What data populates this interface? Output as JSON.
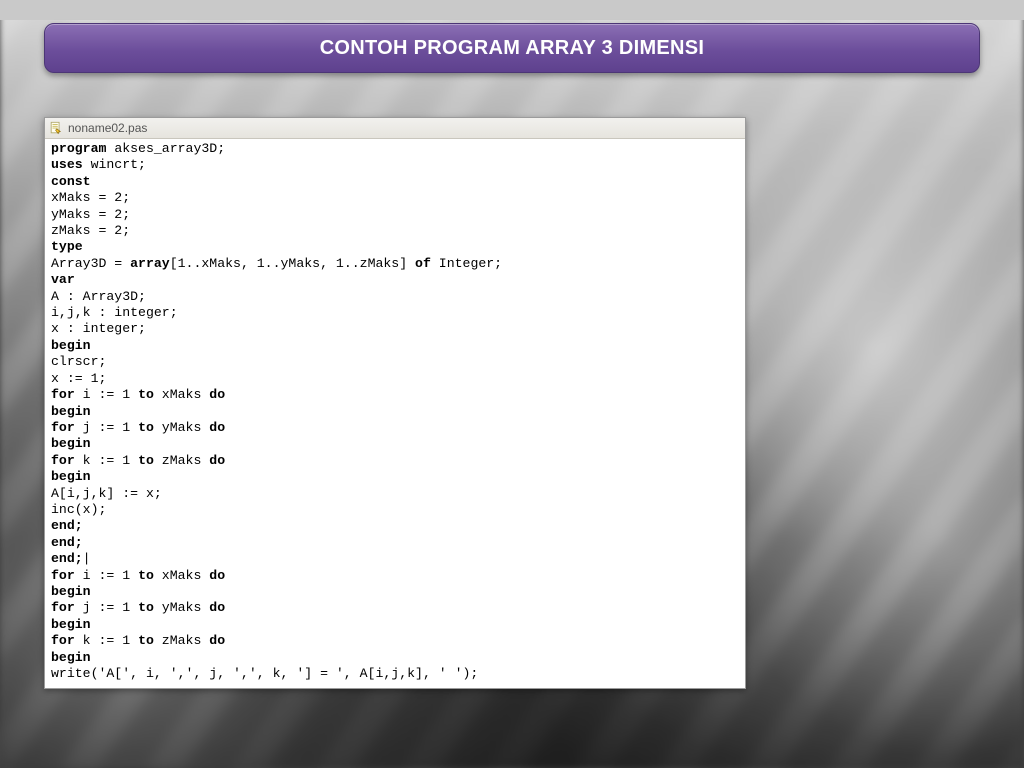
{
  "title": "CONTOH PROGRAM ARRAY 3 DIMENSI",
  "editor": {
    "tab_label": "noname02.pas",
    "code_lines": [
      {
        "k": "program",
        "rest": " akses_array3D;"
      },
      {
        "k": "uses",
        "rest": " wincrt;"
      },
      {
        "k": "const",
        "rest": ""
      },
      {
        "plain": "xMaks = 2;"
      },
      {
        "plain": "yMaks = 2;"
      },
      {
        "plain": "zMaks = 2;"
      },
      {
        "k": "type",
        "rest": ""
      },
      {
        "typedef_pre": "Array3D = ",
        "typedef_mid": "array",
        "typedef_args": "[1..xMaks, 1..yMaks, 1..zMaks] ",
        "typedef_of": "of",
        "typedef_post": " Integer;"
      },
      {
        "k": "var",
        "rest": ""
      },
      {
        "plain": "A : Array3D;"
      },
      {
        "plain": "i,j,k : integer;"
      },
      {
        "plain": "x : integer;"
      },
      {
        "k": "begin",
        "rest": ""
      },
      {
        "plain": "clrscr;"
      },
      {
        "plain": "x := 1;"
      },
      {
        "for_var": "i",
        "for_to": "xMaks"
      },
      {
        "k": "begin",
        "rest": ""
      },
      {
        "for_var": "j",
        "for_to": "yMaks"
      },
      {
        "k": "begin",
        "rest": ""
      },
      {
        "for_var": "k",
        "for_to": "zMaks"
      },
      {
        "k": "begin",
        "rest": ""
      },
      {
        "plain": "A[i,j,k] := x;"
      },
      {
        "plain": "inc(x);"
      },
      {
        "k": "end;",
        "rest": ""
      },
      {
        "k": "end;",
        "rest": ""
      },
      {
        "k": "end;",
        "rest": "|"
      },
      {
        "for_var": "i",
        "for_to": "xMaks"
      },
      {
        "k": "begin",
        "rest": ""
      },
      {
        "for_var": "j",
        "for_to": "yMaks"
      },
      {
        "k": "begin",
        "rest": ""
      },
      {
        "for_var": "k",
        "for_to": "zMaks"
      },
      {
        "k": "begin",
        "rest": ""
      },
      {
        "plain": "write('A[', i, ',', j, ',', k, '] = ', A[i,j,k], ' ');"
      }
    ]
  }
}
